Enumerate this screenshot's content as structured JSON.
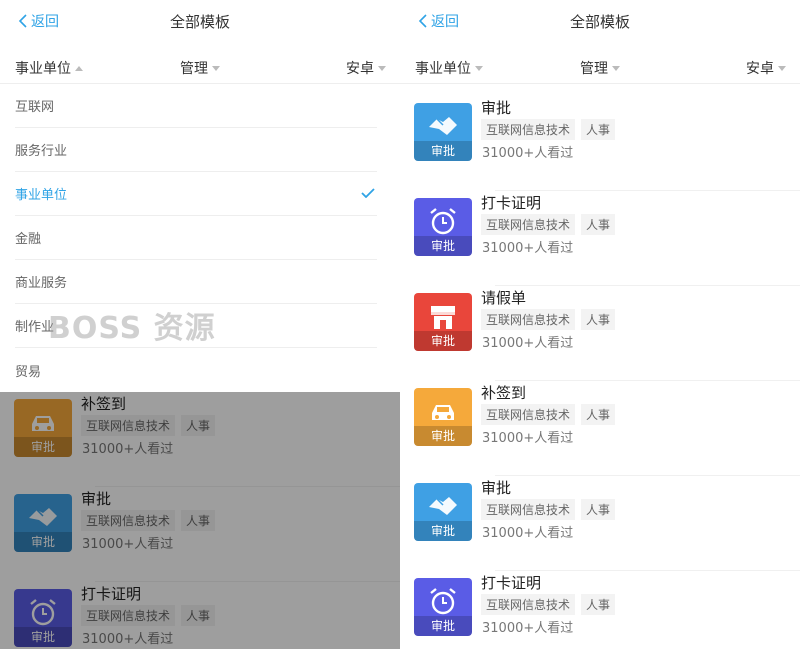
{
  "colors": {
    "accent": "#2fa3e6",
    "handshake": "#3fa0e4",
    "alarm": "#5a5ce6",
    "leave": "#e9463b",
    "car": "#f5a93b"
  },
  "header": {
    "back_label": "返回",
    "title": "全部模板"
  },
  "filters": {
    "industry": "事业单位",
    "manage": "管理",
    "platform": "安卓"
  },
  "dropdown": {
    "options": [
      "互联网",
      "服务行业",
      "事业单位",
      "金融",
      "商业服务",
      "制作业",
      "贸易"
    ],
    "selected": "事业单位"
  },
  "badge_label": "审批",
  "tags": {
    "industry": "互联网信息技术",
    "category": "人事"
  },
  "views": "31000+人看过",
  "templates": [
    {
      "name": "审批",
      "icon": "handshake-icon",
      "color": "#3fa0e4"
    },
    {
      "name": "打卡证明",
      "icon": "alarm-clock-icon",
      "color": "#5a5ce6"
    },
    {
      "name": "请假单",
      "icon": "storefront-icon",
      "color": "#e9463b"
    },
    {
      "name": "补签到",
      "icon": "car-icon",
      "color": "#f5a93b"
    },
    {
      "name": "审批",
      "icon": "handshake-icon",
      "color": "#3fa0e4"
    },
    {
      "name": "打卡证明",
      "icon": "alarm-clock-icon",
      "color": "#5a5ce6"
    }
  ],
  "left_visible_templates": [
    {
      "name": "补签到",
      "icon": "car-icon",
      "color": "#f5a93b"
    },
    {
      "name": "审批",
      "icon": "handshake-icon",
      "color": "#3fa0e4"
    },
    {
      "name": "打卡证明",
      "icon": "alarm-clock-icon",
      "color": "#5a5ce6"
    }
  ],
  "watermark": "BOSS 资源"
}
